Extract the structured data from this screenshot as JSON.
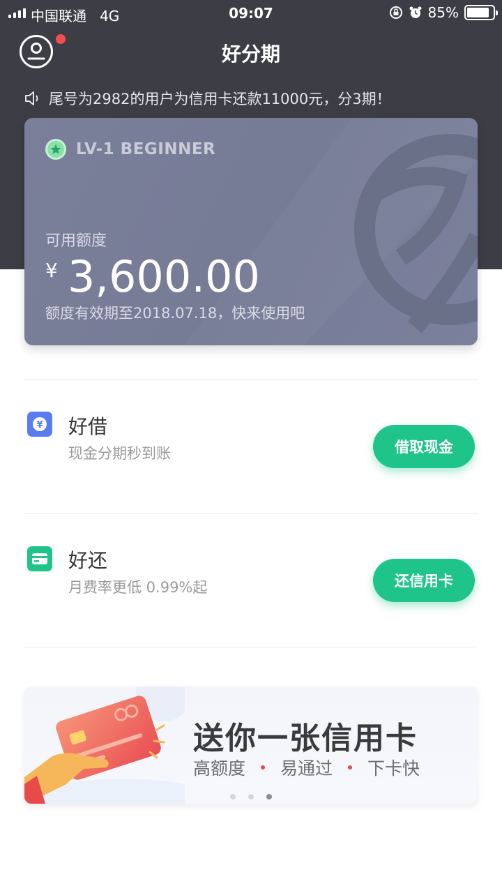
{
  "status_bar": {
    "carrier": "中国联通",
    "network": "4G",
    "time": "09:07",
    "battery_percent": "85%",
    "battery_level": 0.85,
    "icons": [
      "signal-icon",
      "orientation-lock-icon",
      "alarm-icon",
      "battery-icon"
    ]
  },
  "header": {
    "title": "好分期",
    "avatar_icon": "user-avatar-icon",
    "has_notification_dot": true
  },
  "notice": {
    "icon": "speaker-icon",
    "text": "尾号为2982的用户为信用卡还款11000元，分3期！"
  },
  "credit_card": {
    "level": "LV-1  BEGINNER",
    "level_icon": "star-badge-icon",
    "available_label": "可用额度",
    "currency": "¥",
    "amount": "3,600.00",
    "expire_text": "额度有效期至2018.07.18，快来使用吧"
  },
  "services": [
    {
      "icon": "yuan-coin-icon",
      "icon_color": "#5b7cf0",
      "title": "好借",
      "subtitle": "现金分期秒到账",
      "button_label": "借取现金"
    },
    {
      "icon": "card-icon",
      "icon_color": "#1ec48a",
      "title": "好还",
      "subtitle": "月费率更低 0.99%起",
      "button_label": "还信用卡"
    }
  ],
  "banner": {
    "title": "送你一张信用卡",
    "features": [
      "高额度",
      "易通过",
      "下卡快"
    ],
    "page_count": 3,
    "active_page": 3
  },
  "colors": {
    "header_bg": "#3d3e45",
    "card_bg": "#777c97",
    "accent_green": "#1ec48a",
    "notification_red": "#f24e4e"
  }
}
